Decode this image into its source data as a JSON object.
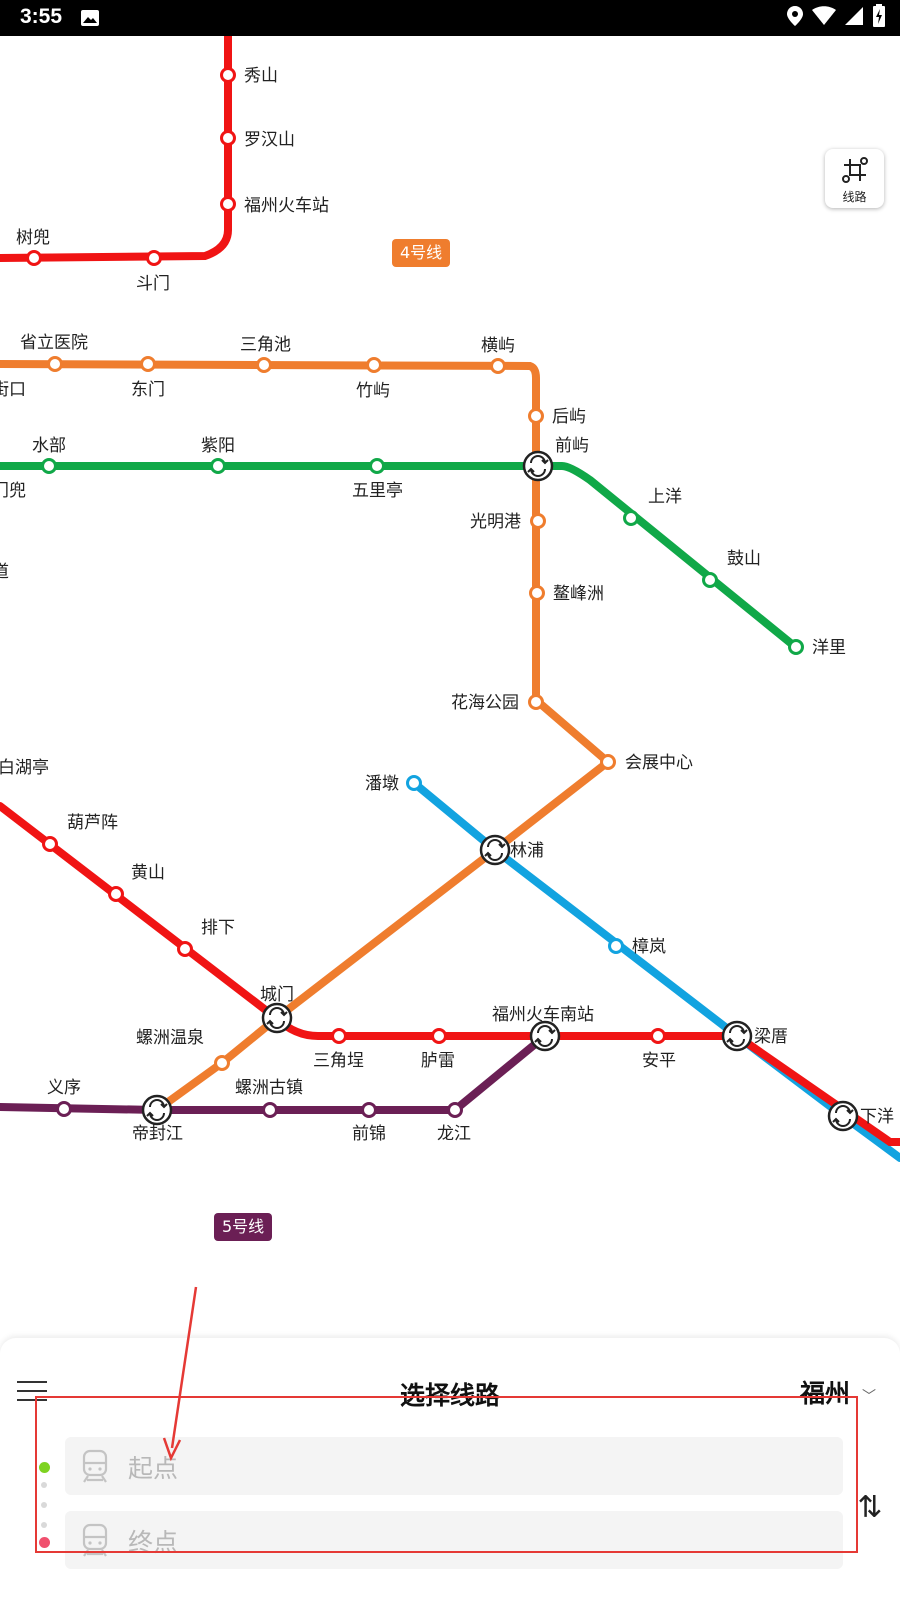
{
  "status_bar": {
    "time": "3:55",
    "icons": [
      "image-icon",
      "location-icon",
      "wifi-icon",
      "battery-charging-icon"
    ]
  },
  "map": {
    "colors": {
      "line1": "#f01414",
      "line2": "#10a848",
      "line4": "#ef7d2e",
      "line5": "#6b1f55",
      "line6": "#12a3e0"
    },
    "line_badges": {
      "line4": "4号线",
      "line5": "5号线"
    },
    "stations": {
      "xiushan": "秀山",
      "luohanshan": "罗汉山",
      "fuzhou_railway": "福州火车站",
      "shudou": "树兜",
      "doumen": "斗门",
      "shengli_hospital": "省立医院",
      "jiekou": "街口",
      "dongmen": "东门",
      "sanjiaochi": "三角池",
      "zhuyu": "竹屿",
      "hengyu": "横屿",
      "houyu": "后屿",
      "qianyu": "前屿",
      "shuibu": "水部",
      "ziyang": "紫阳",
      "wulitng": "五里亭",
      "mendou": "门兜",
      "shangyang": "上洋",
      "gushan": "鼓山",
      "yangli": "洋里",
      "guangminggang": "光明港",
      "aofengzhou": "鳌峰洲",
      "dao": "道",
      "huahai_park": "花海公园",
      "exhibition_center": "会展中心",
      "baihuting": "白湖亭",
      "panduan": "潘墩",
      "hulu_zhen": "葫芦阵",
      "linpu": "林浦",
      "huangshan": "黄山",
      "paixia": "排下",
      "zhanglan": "樟岚",
      "chengmen": "城门",
      "fuzhou_south": "福州火车南站",
      "luozhou_hotspring": "螺洲温泉",
      "sanjiaodi": "三角埕",
      "lulei": "胪雷",
      "anping": "安平",
      "liangcuo": "梁厝",
      "yixu": "义序",
      "luozhou_town": "螺洲古镇",
      "dijiang": "帝封江",
      "qianjin": "前锦",
      "longjiang": "龙江",
      "xiayang": "下洋"
    }
  },
  "line_tool": {
    "label": "线路",
    "icon": "route-icon"
  },
  "sheet": {
    "title": "选择线路",
    "city": "福州",
    "start_placeholder": "起点",
    "end_placeholder": "终点",
    "swap_label": "⇅",
    "start_dot_color": "#7ed321",
    "end_dot_color": "#f0506e"
  },
  "annotation": {
    "color": "#e53935"
  }
}
